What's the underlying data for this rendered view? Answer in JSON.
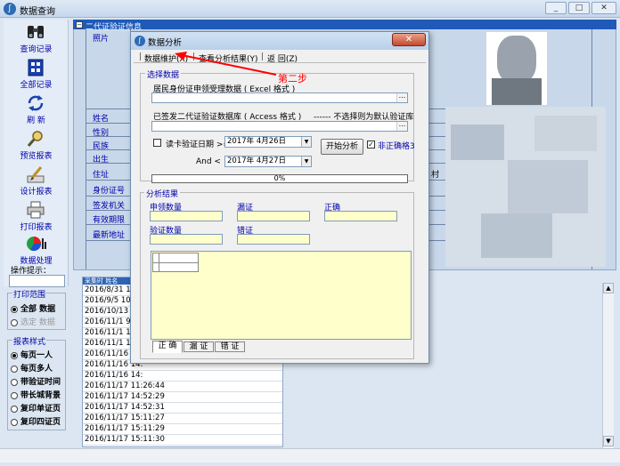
{
  "app": {
    "title": "数据查询",
    "icon": "app-logo-icon"
  },
  "window_buttons": [
    "_",
    "□",
    "✕"
  ],
  "toolbar": {
    "items": [
      {
        "label": "查询记录",
        "icon": "binoculars-icon"
      },
      {
        "label": "全部记录",
        "icon": "grid-icon"
      },
      {
        "label": "刷 新",
        "icon": "refresh-icon"
      },
      {
        "label": "预览报表",
        "icon": "magnifier-icon"
      },
      {
        "label": "设计报表",
        "icon": "design-pen-icon"
      },
      {
        "label": "打印报表",
        "icon": "printer-icon"
      },
      {
        "label": "数据处理",
        "icon": "pie-chart-icon"
      }
    ],
    "hint_label": "操作提示："
  },
  "print_range": {
    "title": "打印范围",
    "options": [
      {
        "label": "全部 数据",
        "checked": true
      },
      {
        "label": "选定 数据",
        "checked": false
      }
    ]
  },
  "report_style": {
    "title": "报表样式",
    "options": [
      {
        "label": "每页一人",
        "checked": true
      },
      {
        "label": "每页多人",
        "checked": false
      },
      {
        "label": "带验证时间",
        "checked": false
      },
      {
        "label": "带长城背景",
        "checked": false
      },
      {
        "label": "复印单证页",
        "checked": false
      },
      {
        "label": "复印四证页",
        "checked": false
      }
    ]
  },
  "background": {
    "header": "二代证验证信息",
    "photo_label": "照片",
    "field_labels": [
      "姓名",
      "性别",
      "民族",
      "出生",
      "住址",
      "身份证号",
      "签发机关",
      "有效期限",
      "最新地址"
    ],
    "partial_text": "村"
  },
  "records": {
    "header": "采集时 姓名",
    "rows": [
      "2016/8/31 15:4",
      "2016/9/5 10:33",
      "2016/10/13 17:",
      "2016/11/1 9:32",
      "2016/11/1 16:",
      "2016/11/1 16:",
      "2016/11/16 14:",
      "2016/11/16 14:",
      "2016/11/16 14:",
      "2016/11/17 11:26:44",
      "2016/11/17 14:52:29",
      "2016/11/17 14:52:31",
      "2016/11/17 15:11:27",
      "2016/11/17 15:11:29",
      "2016/11/17 15:11:30"
    ]
  },
  "dialog": {
    "title": "数据分析",
    "close": "✕",
    "menu": [
      "数据维护(X)",
      "查看分析结果(Y)",
      "返 回(Z)"
    ],
    "menu_sep": "|",
    "select_section": {
      "title": "选择数据",
      "resident_label": "居民身份证申领受理数据 ( Excel 格式 )",
      "issued_label": "已签发二代证验证数据库 ( Access 格式 )",
      "issued_note": "------ 不选择则为默认验证库",
      "browse": "...",
      "date_check_label": "读卡验证日期 >=",
      "date_from": "2017年  4月26日",
      "and_label": "And <",
      "date_to": "2017年  4月27日",
      "analyze_button": "开始分析",
      "precise_label": "非正确格3",
      "precise_checked": true,
      "progress_text": "0%"
    },
    "result_section": {
      "title": "分析结果",
      "labels": [
        "申领数量",
        "漏证",
        "正确",
        "验证数量",
        "错证"
      ],
      "tabs": [
        "正 确",
        "漏 证",
        "错 证"
      ]
    }
  },
  "annotation": {
    "step": "第二步",
    "color": "#ff0000"
  }
}
